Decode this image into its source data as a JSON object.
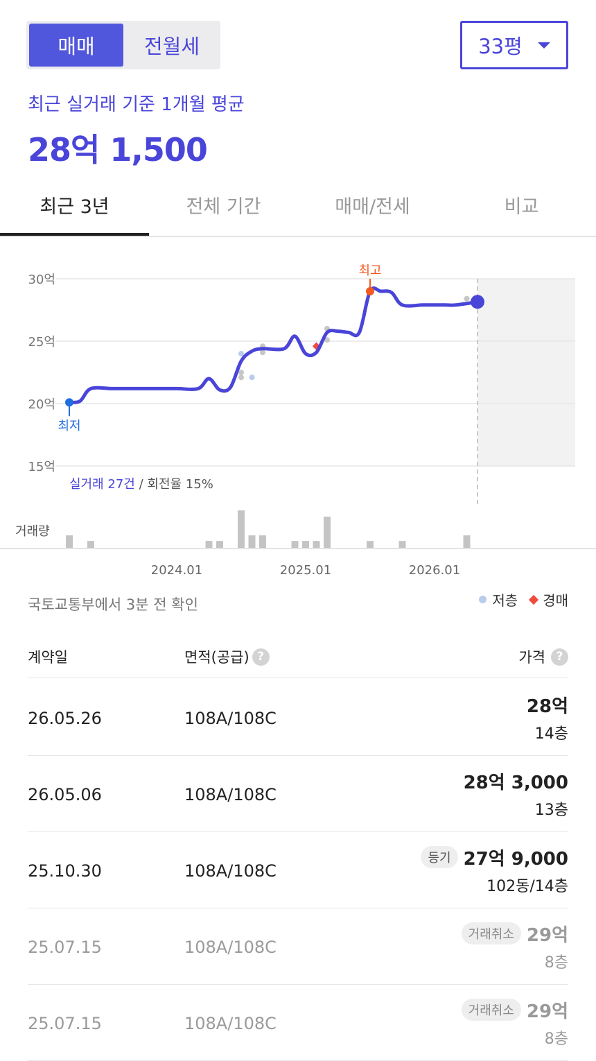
{
  "trade_toggle": {
    "sale": "매매",
    "rent": "전월세"
  },
  "size_select": {
    "value": "33평"
  },
  "summary": {
    "label": "최근 실거래 기준 1개월 평균",
    "value": "28억 1,500"
  },
  "tabs": [
    "최근 3년",
    "전체 기간",
    "매매/전세",
    "비교"
  ],
  "chart_labels": {
    "high": "최고",
    "low": "최저",
    "volume": "거래량",
    "count_prefix": "실거래 27건",
    "count_suffix": " / 회전율 15%"
  },
  "colors": {
    "accent": "#4a45d9",
    "high": "#f25a20",
    "low": "#1f6fe0",
    "auction": "#ef4b3f",
    "low_floor": "#b9ccec"
  },
  "chart_data": {
    "type": "line",
    "x_axis": {
      "min": "2023.03",
      "max": "2026.07",
      "ticks": [
        "2024.01",
        "2025.01",
        "2026.01"
      ]
    },
    "y_axis": {
      "min": 15,
      "max": 30,
      "ticks": [
        "30억",
        "25억",
        "20억",
        "15억"
      ],
      "unit": "억"
    },
    "grid": true,
    "line": [
      {
        "x": "2023.03",
        "y": 20.1
      },
      {
        "x": "2023.04",
        "y": 20.2
      },
      {
        "x": "2023.05",
        "y": 21.2
      },
      {
        "x": "2023.07",
        "y": 21.2
      },
      {
        "x": "2023.09",
        "y": 21.2
      },
      {
        "x": "2023.11",
        "y": 21.2
      },
      {
        "x": "2024.01",
        "y": 21.2
      },
      {
        "x": "2024.03",
        "y": 21.2
      },
      {
        "x": "2024.04",
        "y": 22.0
      },
      {
        "x": "2024.05",
        "y": 21.1
      },
      {
        "x": "2024.06",
        "y": 21.3
      },
      {
        "x": "2024.07",
        "y": 23.4
      },
      {
        "x": "2024.08",
        "y": 24.2
      },
      {
        "x": "2024.09",
        "y": 24.4
      },
      {
        "x": "2024.11",
        "y": 24.4
      },
      {
        "x": "2024.12",
        "y": 25.4
      },
      {
        "x": "2025.01",
        "y": 24.0
      },
      {
        "x": "2025.02",
        "y": 24.1
      },
      {
        "x": "2025.03",
        "y": 25.7
      },
      {
        "x": "2025.04",
        "y": 25.8
      },
      {
        "x": "2025.05",
        "y": 25.7
      },
      {
        "x": "2025.06",
        "y": 25.7
      },
      {
        "x": "2025.07",
        "y": 29.0
      },
      {
        "x": "2025.08",
        "y": 29.0
      },
      {
        "x": "2025.09",
        "y": 28.9
      },
      {
        "x": "2025.10",
        "y": 27.9
      },
      {
        "x": "2025.12",
        "y": 27.9
      },
      {
        "x": "2026.02",
        "y": 27.9
      },
      {
        "x": "2026.03",
        "y": 27.9
      },
      {
        "x": "2026.05",
        "y": 28.15
      }
    ],
    "high_point": {
      "x": "2025.07",
      "y": 29.0,
      "label": "최고"
    },
    "low_point": {
      "x": "2023.03",
      "y": 20.1,
      "label": "최저"
    },
    "current_point": {
      "x": "2026.05",
      "y": 28.15
    },
    "trade_points": [
      {
        "x": "2024.07",
        "y": 24.0,
        "kind": "low_floor"
      },
      {
        "x": "2024.07",
        "y": 22.5,
        "kind": "normal"
      },
      {
        "x": "2024.07",
        "y": 22.1,
        "kind": "normal"
      },
      {
        "x": "2024.08",
        "y": 22.1,
        "kind": "low_floor"
      },
      {
        "x": "2024.09",
        "y": 24.6,
        "kind": "normal"
      },
      {
        "x": "2024.09",
        "y": 24.1,
        "kind": "normal"
      },
      {
        "x": "2025.02",
        "y": 24.6,
        "kind": "auction"
      },
      {
        "x": "2025.03",
        "y": 26.0,
        "kind": "normal"
      },
      {
        "x": "2025.03",
        "y": 25.1,
        "kind": "normal"
      },
      {
        "x": "2026.04",
        "y": 28.4,
        "kind": "normal"
      }
    ],
    "volume": [
      {
        "x": "2023.03",
        "v": 1
      },
      {
        "x": "2023.05",
        "v": 0.55
      },
      {
        "x": "2024.04",
        "v": 0.55
      },
      {
        "x": "2024.05",
        "v": 0.55
      },
      {
        "x": "2024.07",
        "v": 3
      },
      {
        "x": "2024.08",
        "v": 1
      },
      {
        "x": "2024.09",
        "v": 1
      },
      {
        "x": "2024.12",
        "v": 0.55
      },
      {
        "x": "2025.01",
        "v": 0.55
      },
      {
        "x": "2025.02",
        "v": 0.55
      },
      {
        "x": "2025.03",
        "v": 2.5
      },
      {
        "x": "2025.07",
        "v": 0.55
      },
      {
        "x": "2025.10",
        "v": 0.55
      },
      {
        "x": "2026.04",
        "v": 1
      }
    ]
  },
  "source_note": "국토교통부에서 3분 전 확인",
  "legend": {
    "low_floor": "저층",
    "auction": "경매"
  },
  "table": {
    "headers": {
      "date": "계약일",
      "area": "면적(공급)",
      "price": "가격"
    },
    "help_icon": "?",
    "rows": [
      {
        "date": "26.05.26",
        "area": "108A/108C",
        "badge": "",
        "price": "28억",
        "floor": "14층",
        "cancelled": false
      },
      {
        "date": "26.05.06",
        "area": "108A/108C",
        "badge": "",
        "price": "28억 3,000",
        "floor": "13층",
        "cancelled": false
      },
      {
        "date": "25.10.30",
        "area": "108A/108C",
        "badge": "등기",
        "price": "27억 9,000",
        "floor": "102동/14층",
        "cancelled": false
      },
      {
        "date": "25.07.15",
        "area": "108A/108C",
        "badge": "거래취소",
        "price": "29억",
        "floor": "8층",
        "cancelled": true
      },
      {
        "date": "25.07.15",
        "area": "108A/108C",
        "badge": "거래취소",
        "price": "29억",
        "floor": "8층",
        "cancelled": true
      }
    ]
  }
}
